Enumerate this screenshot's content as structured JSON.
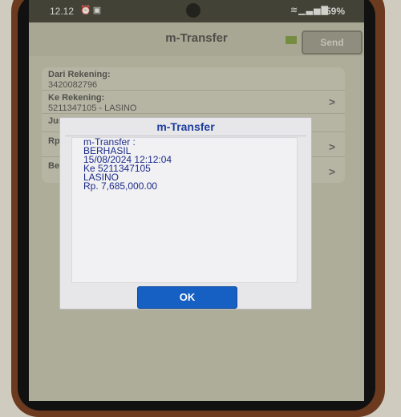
{
  "status_bar": {
    "time": "12.12",
    "battery": "59%"
  },
  "app": {
    "title": "m-Transfer",
    "send_label": "Send"
  },
  "form": {
    "from_label": "Dari Rekening:",
    "from_value": "3420082796",
    "to_label": "Ke Rekening:",
    "to_value": "5211347105 - LASINO",
    "amount_label_partial": "Jumla",
    "currency_label": "Rp",
    "note_label_partial": "Berita"
  },
  "dialog": {
    "title": "m-Transfer",
    "lines": [
      "m-Transfer :",
      "BERHASIL",
      "15/08/2024 12:12:04",
      "Ke 5211347105",
      "LASINO",
      "Rp. 7,685,000.00"
    ],
    "ok_label": "OK"
  }
}
